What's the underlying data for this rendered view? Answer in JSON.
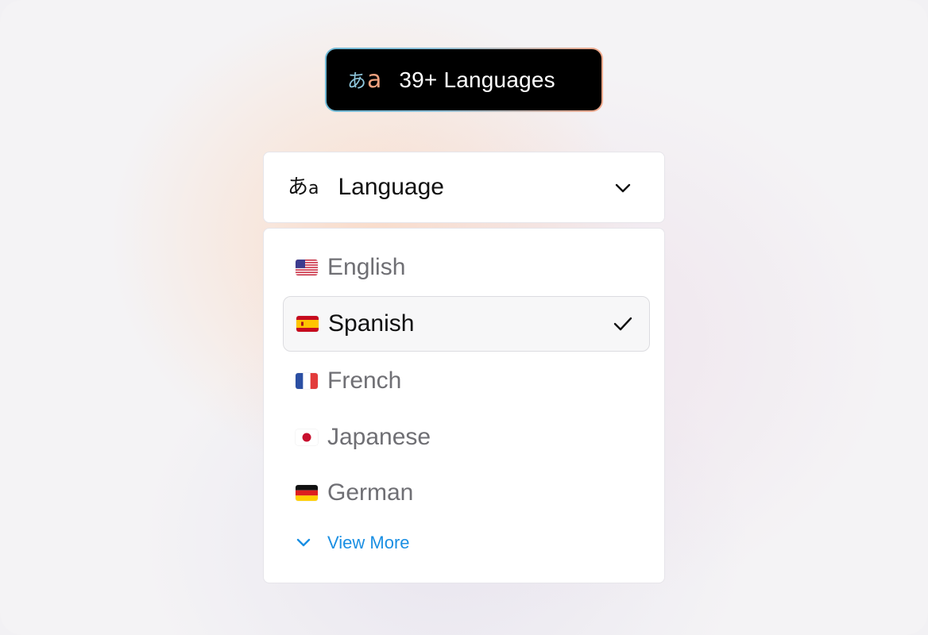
{
  "badge": {
    "icon_char_1": "あ",
    "icon_char_2": "a",
    "icon": "language-translate-icon",
    "text": "39+ Languages"
  },
  "select": {
    "icon_char_1": "あ",
    "icon_char_2": "a",
    "icon": "language-translate-icon",
    "label": "Language",
    "chevron_icon": "chevron-down-icon"
  },
  "dropdown": {
    "options": [
      {
        "label": "English",
        "flag": "us-flag-icon",
        "selected": false
      },
      {
        "label": "Spanish",
        "flag": "spain-flag-icon",
        "selected": true
      },
      {
        "label": "French",
        "flag": "france-flag-icon",
        "selected": false
      },
      {
        "label": "Japanese",
        "flag": "japan-flag-icon",
        "selected": false
      },
      {
        "label": "German",
        "flag": "germany-flag-icon",
        "selected": false
      }
    ],
    "check_icon": "checkmark-icon",
    "view_more": {
      "label": "View More",
      "icon": "chevron-down-icon"
    }
  },
  "colors": {
    "accent_link": "#1a8fe3",
    "badge_bg": "#000000",
    "badge_gradient_start": "#6fb9d6",
    "badge_gradient_end": "#f0a88a"
  }
}
